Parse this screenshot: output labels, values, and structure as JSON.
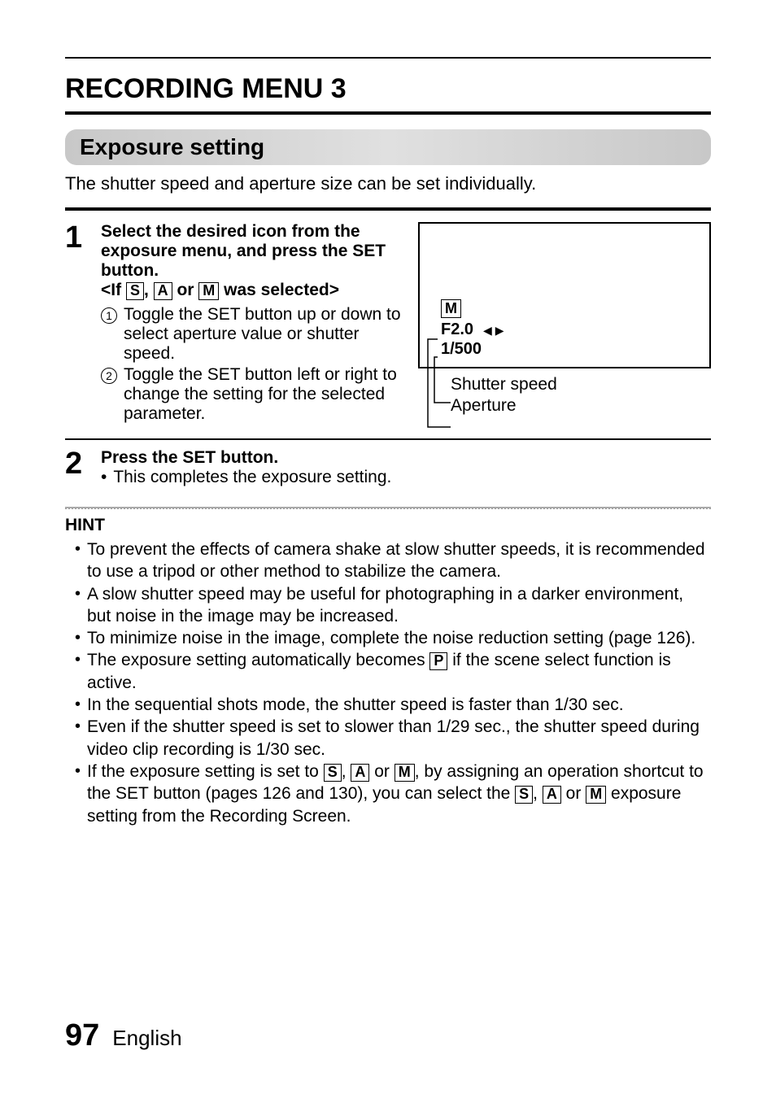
{
  "page": {
    "title": "RECORDING MENU 3",
    "section_heading": "Exposure setting",
    "intro": "The shutter speed and aperture size can be set individually.",
    "number": "97",
    "language": "English"
  },
  "icons": {
    "S": "S",
    "A": "A",
    "M": "M",
    "P": "P"
  },
  "step1": {
    "num": "1",
    "heading": "Select the desired icon from the exposure menu, and press the SET button.",
    "cond_prefix": "<If ",
    "cond_mid1": ", ",
    "cond_mid2": " or ",
    "cond_suffix": " was selected>",
    "sub1_num": "1",
    "sub1_text": "Toggle the SET button up or down to select aperture value or shutter speed.",
    "sub2_num": "2",
    "sub2_text": "Toggle the SET button left or right to change the setting for the selected parameter."
  },
  "diagram": {
    "mode": "M",
    "aperture": "F2.0",
    "arrows": "◀ ▶",
    "shutter": "1/500",
    "label_shutter": "Shutter speed",
    "label_aperture": "Aperture"
  },
  "step2": {
    "num": "2",
    "heading": "Press the SET button.",
    "bullet_mark": "•",
    "bullet_text": "This completes the exposure setting."
  },
  "hint": {
    "heading": "HINT",
    "bullet": "•",
    "items": [
      "To prevent the effects of camera shake at slow shutter speeds, it is recommended to use a tripod or other method to stabilize the camera.",
      "A slow shutter speed may be useful for photographing in a darker environment, but noise in the image may be increased.",
      "To minimize noise in the image, complete the noise reduction setting (page 126)."
    ],
    "item4_a": "The exposure setting automatically becomes ",
    "item4_b": " if the scene select function is active.",
    "item5": "In the sequential shots mode, the shutter speed is faster than 1/30 sec.",
    "item6": "Even if the shutter speed is set to slower than 1/29 sec., the shutter speed during video clip recording is 1/30 sec.",
    "item7_a": "If the exposure setting is set to ",
    "item7_b": ", ",
    "item7_c": " or ",
    "item7_d": ", by assigning an operation shortcut to the SET button (pages 126 and 130), you can select the ",
    "item7_e": ", ",
    "item7_f": " or ",
    "item7_g": " exposure setting from the Recording Screen."
  }
}
